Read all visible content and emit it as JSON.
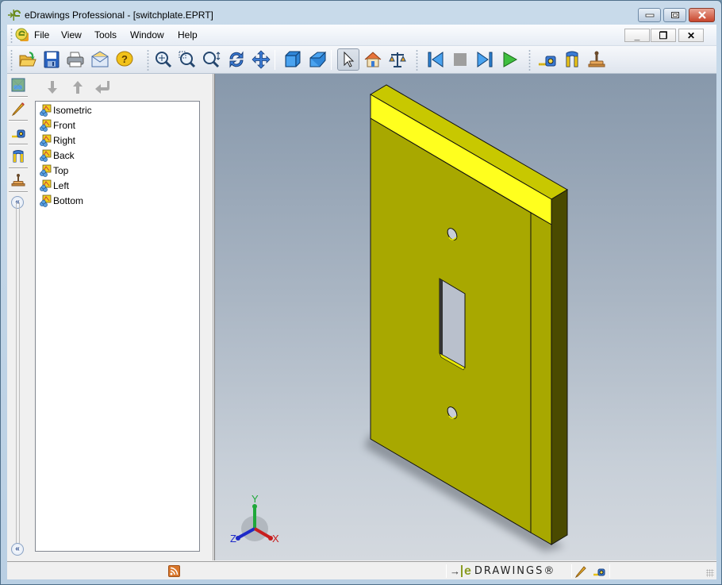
{
  "window": {
    "title": "eDrawings Professional - [switchplate.EPRT]",
    "controls": {
      "minimize": "minimize",
      "maximize": "maximize",
      "close": "close"
    }
  },
  "menubar": {
    "items": [
      {
        "label": "File"
      },
      {
        "label": "View"
      },
      {
        "label": "Tools"
      },
      {
        "label": "Window"
      },
      {
        "label": "Help"
      }
    ],
    "mdi_controls": {
      "minimize": "_",
      "restore": "❐",
      "close": "✕"
    }
  },
  "toolbar": {
    "groups": [
      [
        {
          "name": "open",
          "icon": "folder-open-icon"
        },
        {
          "name": "save",
          "icon": "save-icon"
        },
        {
          "name": "print",
          "icon": "printer-icon"
        },
        {
          "name": "send",
          "icon": "mail-icon"
        },
        {
          "name": "help",
          "icon": "help-icon"
        }
      ],
      [
        {
          "name": "zoom-to-fit",
          "icon": "zoom-fit-icon"
        },
        {
          "name": "zoom-to-area",
          "icon": "zoom-area-icon"
        },
        {
          "name": "zoom-in-out",
          "icon": "zoom-in-out-icon"
        },
        {
          "name": "rotate",
          "icon": "rotate-icon"
        },
        {
          "name": "pan",
          "icon": "pan-icon"
        },
        {
          "name": "shaded",
          "icon": "shaded-box-icon"
        },
        {
          "name": "perspective",
          "icon": "perspective-icon"
        },
        {
          "name": "select",
          "icon": "select-arrow-icon",
          "active": true
        },
        {
          "name": "home",
          "icon": "home-icon"
        },
        {
          "name": "mass-properties",
          "icon": "scale-icon"
        }
      ],
      [
        {
          "name": "first-frame",
          "icon": "skip-back-icon"
        },
        {
          "name": "stop",
          "icon": "stop-icon"
        },
        {
          "name": "next-frame",
          "icon": "skip-forward-icon"
        },
        {
          "name": "play",
          "icon": "play-icon"
        }
      ],
      [
        {
          "name": "measure",
          "icon": "tape-measure-icon"
        },
        {
          "name": "section",
          "icon": "section-icon"
        },
        {
          "name": "stamp",
          "icon": "stamp-icon"
        }
      ]
    ]
  },
  "left_strip": {
    "items": [
      {
        "name": "views",
        "icon": "views-icon"
      },
      {
        "name": "markup",
        "icon": "pencil-icon"
      },
      {
        "name": "measure",
        "icon": "tape-measure-icon"
      },
      {
        "name": "section",
        "icon": "section-icon"
      },
      {
        "name": "stamp",
        "icon": "stamp-icon"
      }
    ],
    "collapse_label": "«"
  },
  "panel": {
    "nav": [
      {
        "name": "move-down",
        "glyph": "↓"
      },
      {
        "name": "move-up",
        "glyph": "↑"
      },
      {
        "name": "return",
        "glyph": "↵"
      }
    ],
    "views": [
      {
        "label": "Isometric"
      },
      {
        "label": "Front"
      },
      {
        "label": "Right"
      },
      {
        "label": "Back"
      },
      {
        "label": "Top"
      },
      {
        "label": "Left"
      },
      {
        "label": "Bottom"
      }
    ]
  },
  "viewport": {
    "model_name": "switchplate",
    "model_color": "#a8a800",
    "triad": {
      "x": "X",
      "y": "Y",
      "z": "Z",
      "x_color": "#c81e1e",
      "y_color": "#1fa83a",
      "z_color": "#1e2ac8"
    }
  },
  "statusbar": {
    "brand": "DRAWINGS®",
    "brand_prefix": "e",
    "tools": [
      {
        "name": "markup",
        "icon": "pencil-icon"
      },
      {
        "name": "measure",
        "icon": "tape-measure-icon"
      }
    ]
  }
}
